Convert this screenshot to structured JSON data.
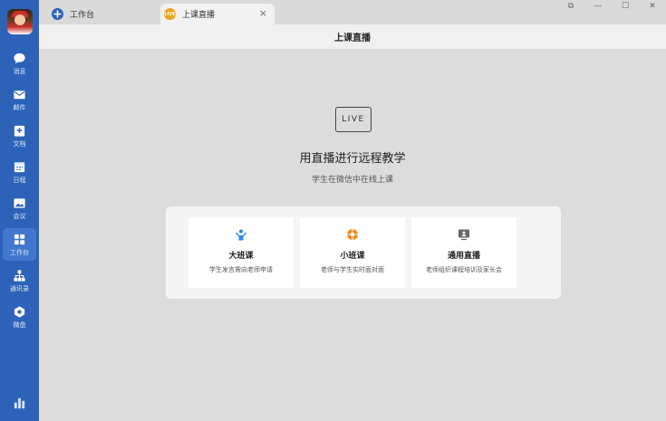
{
  "sidebar": {
    "items": [
      {
        "label": "消息",
        "icon": "chat-bubble-icon"
      },
      {
        "label": "邮件",
        "icon": "mail-icon"
      },
      {
        "label": "文档",
        "icon": "document-icon"
      },
      {
        "label": "日程",
        "icon": "calendar-icon"
      },
      {
        "label": "会议",
        "icon": "meeting-icon"
      },
      {
        "label": "工作台",
        "icon": "workbench-grid-icon",
        "active": true
      },
      {
        "label": "通讯录",
        "icon": "org-chart-icon"
      },
      {
        "label": "微盘",
        "icon": "cloud-drive-icon"
      }
    ],
    "bottom_icon": "bar-chart-icon",
    "accent": "#2c63b8"
  },
  "tabs": [
    {
      "label": "工作台",
      "icon": "workbench-tab-icon",
      "closable": false
    },
    {
      "label": "上课直播",
      "icon": "live-tab-icon",
      "icon_text": "LIVE",
      "closable": true,
      "active": true
    }
  ],
  "tab_close": "×",
  "window_controls": {
    "pin": "⧉",
    "minimize": "—",
    "maximize": "☐",
    "close": "✕"
  },
  "header": {
    "title": "上课直播"
  },
  "main": {
    "badge": "LIVE",
    "title": "用直播进行远程教学",
    "subtitle": "学生在微信中在线上课",
    "cards": [
      {
        "title": "大班课",
        "desc": "学生发言需向老师申请",
        "icon": "raise-hand-icon",
        "icon_color": "#2c8be8"
      },
      {
        "title": "小班课",
        "desc": "老师与学生实时面对面",
        "icon": "target-circle-icon",
        "icon_color": "#f08a22"
      },
      {
        "title": "通用直播",
        "desc": "老师组织课程培训及家长会",
        "icon": "monitor-person-icon",
        "icon_color": "#666666"
      }
    ]
  }
}
